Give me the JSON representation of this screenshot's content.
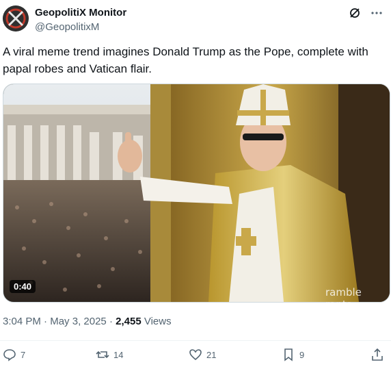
{
  "post": {
    "author_name": "GeopolitiX Monitor",
    "author_handle": "@GeopolitixM",
    "text": "A viral meme trend imagines Donald Trump as the Pope, complete with papal robes and Vatican flair.",
    "media": {
      "duration": "0:40",
      "watermark": "ramble rants"
    },
    "time": "3:04 PM",
    "date": "May 3, 2025",
    "views_count": "2,455",
    "views_label": "Views",
    "separator": "·"
  },
  "actions": {
    "replies": "7",
    "reposts": "14",
    "likes": "21",
    "bookmarks": "9"
  },
  "icons": [
    "grok-icon",
    "more-icon",
    "reply-icon",
    "repost-icon",
    "like-icon",
    "bookmark-icon",
    "share-icon"
  ],
  "colors": {
    "text": "#0f1419",
    "muted": "#536471",
    "border": "#cfd9de"
  }
}
